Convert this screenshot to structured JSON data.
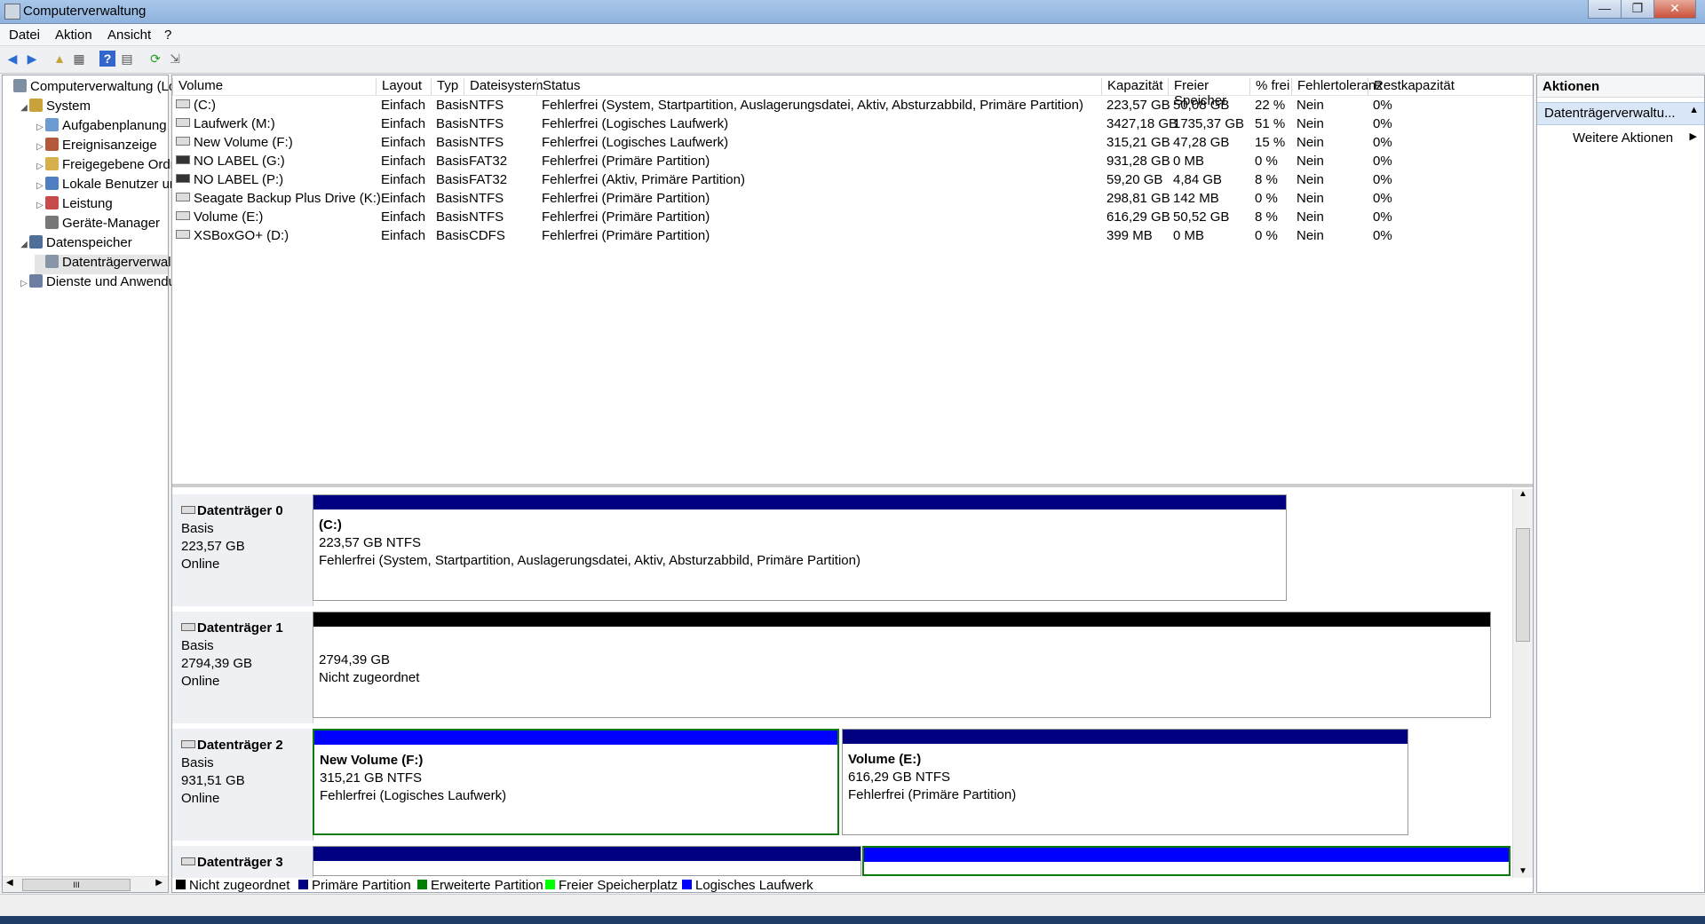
{
  "window": {
    "title": "Computerverwaltung",
    "min": "—",
    "max": "❐",
    "close": "✕"
  },
  "menu": [
    "Datei",
    "Aktion",
    "Ansicht",
    "?"
  ],
  "toolbar_icons": [
    "back-icon",
    "forward-icon",
    "up-folder-icon",
    "console-tree-icon",
    "help-icon",
    "properties-icon",
    "refresh-icon",
    "export-icon"
  ],
  "tree": [
    {
      "label": "Computerverwaltung (Lo",
      "level": 0,
      "expander": ""
    },
    {
      "label": "System",
      "level": 1,
      "expander": "◢"
    },
    {
      "label": "Aufgabenplanung",
      "level": 2,
      "expander": "▷"
    },
    {
      "label": "Ereignisanzeige",
      "level": 2,
      "expander": "▷"
    },
    {
      "label": "Freigegebene Ordn",
      "level": 2,
      "expander": "▷"
    },
    {
      "label": "Lokale Benutzer un",
      "level": 2,
      "expander": "▷"
    },
    {
      "label": "Leistung",
      "level": 2,
      "expander": "▷"
    },
    {
      "label": "Geräte-Manager",
      "level": 2,
      "expander": ""
    },
    {
      "label": "Datenspeicher",
      "level": 1,
      "expander": "◢"
    },
    {
      "label": "Datenträgerverwal",
      "level": 2,
      "expander": "",
      "selected": true
    },
    {
      "label": "Dienste und Anwendu",
      "level": 1,
      "expander": "▷"
    }
  ],
  "scroll_glyph": "III",
  "columns": [
    "Volume",
    "Layout",
    "Typ",
    "Dateisystem",
    "Status",
    "Kapazität",
    "Freier Speicher",
    "% frei",
    "Fehlertoleranz",
    "Restkapazität"
  ],
  "volumes": [
    [
      "(C:)",
      "Einfach",
      "Basis",
      "NTFS",
      "Fehlerfrei (System, Startpartition, Auslagerungsdatei, Aktiv, Absturzabbild, Primäre Partition)",
      "223,57 GB",
      "50,08 GB",
      "22 %",
      "Nein",
      "0%"
    ],
    [
      "Laufwerk (M:)",
      "Einfach",
      "Basis",
      "NTFS",
      "Fehlerfrei (Logisches Laufwerk)",
      "3427,18 GB",
      "1735,37 GB",
      "51 %",
      "Nein",
      "0%"
    ],
    [
      "New Volume (F:)",
      "Einfach",
      "Basis",
      "NTFS",
      "Fehlerfrei (Logisches Laufwerk)",
      "315,21 GB",
      "47,28 GB",
      "15 %",
      "Nein",
      "0%"
    ],
    [
      "NO LABEL (G:)",
      "Einfach",
      "Basis",
      "FAT32",
      "Fehlerfrei (Primäre Partition)",
      "931,28 GB",
      "0 MB",
      "0 %",
      "Nein",
      "0%"
    ],
    [
      "NO LABEL (P:)",
      "Einfach",
      "Basis",
      "FAT32",
      "Fehlerfrei (Aktiv, Primäre Partition)",
      "59,20 GB",
      "4,84 GB",
      "8 %",
      "Nein",
      "0%"
    ],
    [
      "Seagate Backup Plus Drive (K:)",
      "Einfach",
      "Basis",
      "NTFS",
      "Fehlerfrei (Primäre Partition)",
      "298,81 GB",
      "142 MB",
      "0 %",
      "Nein",
      "0%"
    ],
    [
      "Volume (E:)",
      "Einfach",
      "Basis",
      "NTFS",
      "Fehlerfrei (Primäre Partition)",
      "616,29 GB",
      "50,52 GB",
      "8 %",
      "Nein",
      "0%"
    ],
    [
      "XSBoxGO+ (D:)",
      "Einfach",
      "Basis",
      "CDFS",
      "Fehlerfrei (Primäre Partition)",
      "399 MB",
      "0 MB",
      "0 %",
      "Nein",
      "0%"
    ]
  ],
  "disks": [
    {
      "name": "Datenträger 0",
      "type": "Basis",
      "size": "223,57 GB",
      "state": "Online",
      "partitions": [
        {
          "title": "(C:)",
          "line2": "223,57 GB NTFS",
          "line3": "Fehlerfrei (System, Startpartition, Auslagerungsdatei, Aktiv, Absturzabbild, Primäre Partition)"
        }
      ]
    },
    {
      "name": "Datenträger 1",
      "type": "Basis",
      "size": "2794,39 GB",
      "state": "Online",
      "partitions": [
        {
          "title": "",
          "line2": "2794,39 GB",
          "line3": "Nicht zugeordnet"
        }
      ]
    },
    {
      "name": "Datenträger 2",
      "type": "Basis",
      "size": "931,51 GB",
      "state": "Online",
      "partitions": [
        {
          "title": "New Volume  (F:)",
          "line2": "315,21 GB NTFS",
          "line3": "Fehlerfrei (Logisches Laufwerk)"
        },
        {
          "title": "Volume  (E:)",
          "line2": "616,29 GB NTFS",
          "line3": "Fehlerfrei (Primäre Partition)"
        }
      ]
    },
    {
      "name": "Datenträger 3"
    }
  ],
  "legend": [
    {
      "label": "Nicht zugeordnet",
      "color": "#000000"
    },
    {
      "label": "Primäre Partition",
      "color": "#000080"
    },
    {
      "label": "Erweiterte Partition",
      "color": "#008000"
    },
    {
      "label": "Freier Speicherplatz",
      "color": "#00ff00"
    },
    {
      "label": "Logisches Laufwerk",
      "color": "#0000ff"
    }
  ],
  "actions": {
    "header": "Aktionen",
    "section": "Datenträgerverwaltu...",
    "more": "Weitere Aktionen"
  }
}
